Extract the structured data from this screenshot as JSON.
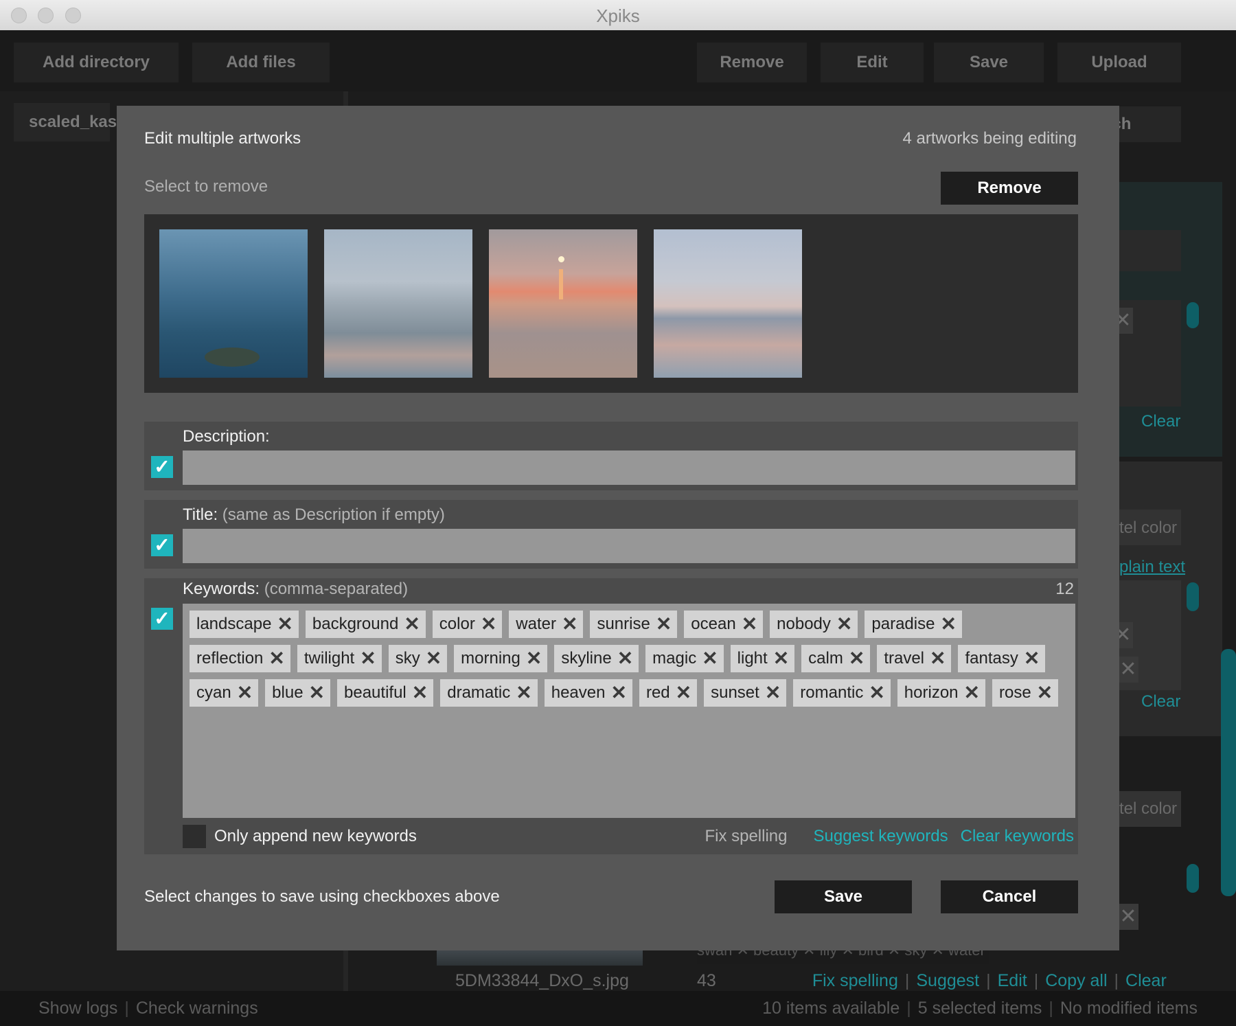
{
  "window": {
    "title": "Xpiks"
  },
  "toolbar": {
    "add_directory": "Add directory",
    "add_files": "Add files",
    "remove": "Remove",
    "edit": "Edit",
    "save": "Save",
    "upload": "Upload"
  },
  "background": {
    "directory": "scaled_kas",
    "search": "rch",
    "clear": "Clear",
    "tel_color": "tel color",
    "plain_text": "plain text",
    "filename": "5DM33844_DxO_s.jpg",
    "keyword_count": "43",
    "item_links": [
      "Fix spelling",
      "Suggest",
      "Edit",
      "Copy all",
      "Clear"
    ],
    "bg_tags": "swan ✕ beauty ✕ lily ✕ bird ✕ sky ✕ water ✕"
  },
  "statusbar": {
    "show_logs": "Show logs",
    "check_warnings": "Check warnings",
    "items_available": "10 items available",
    "selected_items": "5 selected items",
    "modified_items": "No modified items"
  },
  "dialog": {
    "title": "Edit multiple artworks",
    "count": "4 artworks being editing",
    "select_to_remove": "Select to remove",
    "remove_button": "Remove",
    "description": {
      "label": "Description:",
      "value": "",
      "checked": true
    },
    "title_field": {
      "label": "Title:",
      "hint": "(same as Description if empty)",
      "value": "",
      "checked": true
    },
    "keywords": {
      "label": "Keywords:",
      "hint": "(comma-separated)",
      "count": "12",
      "checked": true,
      "rows": [
        [
          "landscape",
          "background",
          "color",
          "water",
          "sunrise",
          "ocean",
          "nobody",
          "paradise"
        ],
        [
          "reflection",
          "twilight",
          "sky",
          "morning",
          "skyline",
          "magic",
          "light",
          "calm",
          "travel",
          "fantasy"
        ],
        [
          "cyan",
          "blue",
          "beautiful",
          "dramatic",
          "heaven",
          "red",
          "sunset",
          "romantic",
          "horizon",
          "rose"
        ]
      ],
      "only_append": "Only append new keywords",
      "fix_spelling": "Fix spelling",
      "suggest_keywords": "Suggest keywords",
      "clear_keywords": "Clear keywords"
    },
    "footer_hint": "Select changes to save using checkboxes above",
    "save_button": "Save",
    "cancel_button": "Cancel"
  },
  "colors": {
    "accent": "#1fb5bd",
    "dialog_bg": "#575757",
    "button_bg": "#1e1e1e"
  }
}
